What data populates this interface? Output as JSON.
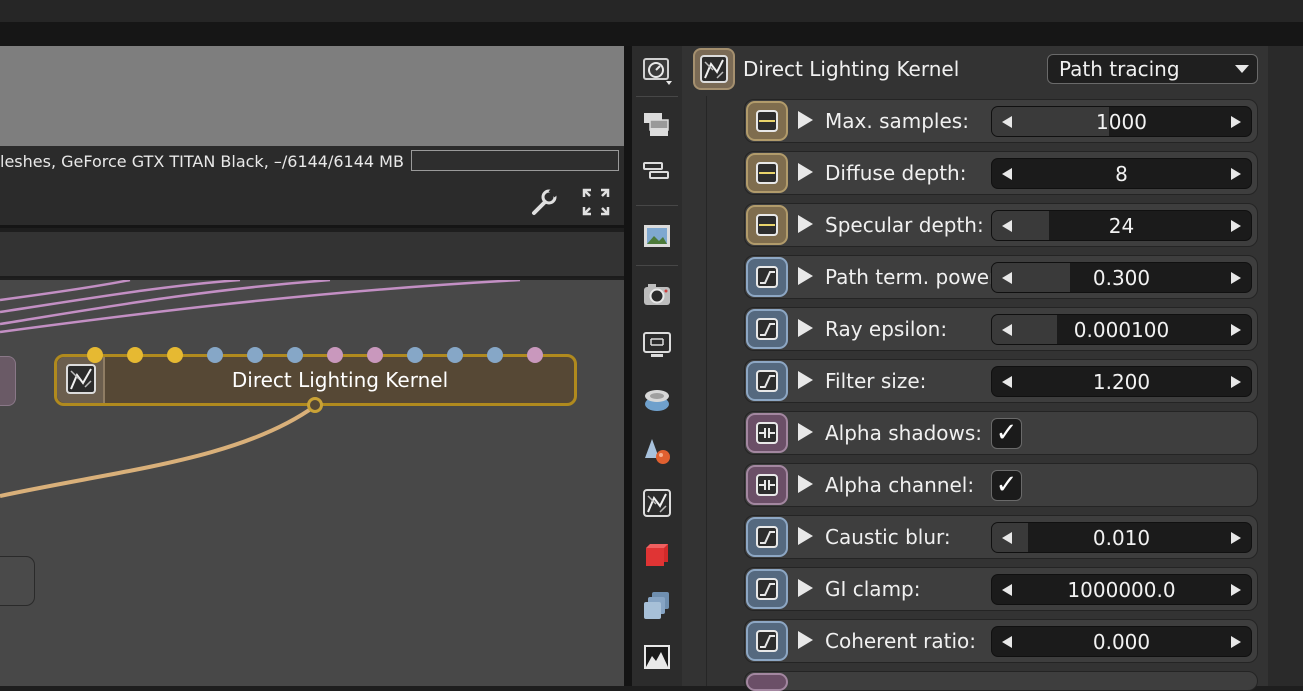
{
  "viewport": {
    "status_text": "leshes, GeForce GTX TITAN Black, –/6144/6144 MB"
  },
  "icons": {
    "wrench": "wrench-icon",
    "expand": "expand-icon",
    "toolbar": [
      "render-target-icon",
      "windows-icon",
      "layers-icon",
      "image-icon",
      "camera-icon",
      "display-icon",
      "environment-icon",
      "material-icon",
      "kernel-icon",
      "cube-icon",
      "objects-icon",
      "imager-icon"
    ]
  },
  "graph": {
    "node": {
      "title": "Direct Lighting Kernel",
      "pin_colors": [
        "#e6b932",
        "#e6b932",
        "#e6b932",
        "#86a7c7",
        "#86a7c7",
        "#86a7c7",
        "#c998bd",
        "#c998bd",
        "#86a7c7",
        "#86a7c7",
        "#86a7c7",
        "#c998bd"
      ]
    }
  },
  "inspector": {
    "title": "Direct Lighting Kernel",
    "mode": "Path tracing",
    "rows": [
      {
        "label": "Max. samples:",
        "type": "int",
        "value": "1000",
        "fill": 0.45
      },
      {
        "label": "Diffuse depth:",
        "type": "int",
        "value": "8",
        "fill": 0.0
      },
      {
        "label": "Specular depth:",
        "type": "int",
        "value": "24",
        "fill": 0.22
      },
      {
        "label": "Path term. power:",
        "type": "float",
        "value": "0.300",
        "fill": 0.3
      },
      {
        "label": "Ray epsilon:",
        "type": "float",
        "value": "0.000100",
        "fill": 0.25
      },
      {
        "label": "Filter size:",
        "type": "float",
        "value": "1.200",
        "fill": 0.0
      },
      {
        "label": "Alpha shadows:",
        "type": "bool",
        "value": "✓"
      },
      {
        "label": "Alpha channel:",
        "type": "bool",
        "value": "✓"
      },
      {
        "label": "Caustic blur:",
        "type": "float",
        "value": "0.010",
        "fill": 0.14
      },
      {
        "label": "GI clamp:",
        "type": "float",
        "value": "1000000.0",
        "fill": 0.0
      },
      {
        "label": "Coherent ratio:",
        "type": "float",
        "value": "0.000",
        "fill": 0.0
      }
    ]
  },
  "colors": {
    "accent_gold": "#b08a1e",
    "wire": "#d9b07a",
    "wire_pink": "#c38fc4"
  }
}
